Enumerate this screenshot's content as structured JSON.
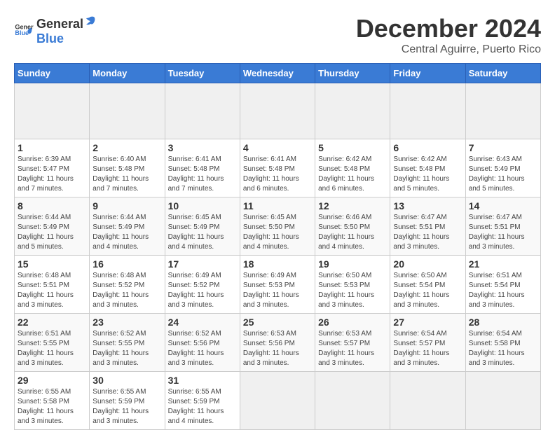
{
  "header": {
    "logo_general": "General",
    "logo_blue": "Blue",
    "month_title": "December 2024",
    "location": "Central Aguirre, Puerto Rico"
  },
  "calendar": {
    "days_of_week": [
      "Sunday",
      "Monday",
      "Tuesday",
      "Wednesday",
      "Thursday",
      "Friday",
      "Saturday"
    ],
    "weeks": [
      [
        {
          "day": "",
          "empty": true
        },
        {
          "day": "",
          "empty": true
        },
        {
          "day": "",
          "empty": true
        },
        {
          "day": "",
          "empty": true
        },
        {
          "day": "",
          "empty": true
        },
        {
          "day": "",
          "empty": true
        },
        {
          "day": "",
          "empty": true
        }
      ],
      [
        {
          "day": "1",
          "sunrise": "6:39 AM",
          "sunset": "5:47 PM",
          "daylight": "11 hours and 7 minutes."
        },
        {
          "day": "2",
          "sunrise": "6:40 AM",
          "sunset": "5:48 PM",
          "daylight": "11 hours and 7 minutes."
        },
        {
          "day": "3",
          "sunrise": "6:41 AM",
          "sunset": "5:48 PM",
          "daylight": "11 hours and 7 minutes."
        },
        {
          "day": "4",
          "sunrise": "6:41 AM",
          "sunset": "5:48 PM",
          "daylight": "11 hours and 6 minutes."
        },
        {
          "day": "5",
          "sunrise": "6:42 AM",
          "sunset": "5:48 PM",
          "daylight": "11 hours and 6 minutes."
        },
        {
          "day": "6",
          "sunrise": "6:42 AM",
          "sunset": "5:48 PM",
          "daylight": "11 hours and 5 minutes."
        },
        {
          "day": "7",
          "sunrise": "6:43 AM",
          "sunset": "5:49 PM",
          "daylight": "11 hours and 5 minutes."
        }
      ],
      [
        {
          "day": "8",
          "sunrise": "6:44 AM",
          "sunset": "5:49 PM",
          "daylight": "11 hours and 5 minutes."
        },
        {
          "day": "9",
          "sunrise": "6:44 AM",
          "sunset": "5:49 PM",
          "daylight": "11 hours and 4 minutes."
        },
        {
          "day": "10",
          "sunrise": "6:45 AM",
          "sunset": "5:49 PM",
          "daylight": "11 hours and 4 minutes."
        },
        {
          "day": "11",
          "sunrise": "6:45 AM",
          "sunset": "5:50 PM",
          "daylight": "11 hours and 4 minutes."
        },
        {
          "day": "12",
          "sunrise": "6:46 AM",
          "sunset": "5:50 PM",
          "daylight": "11 hours and 4 minutes."
        },
        {
          "day": "13",
          "sunrise": "6:47 AM",
          "sunset": "5:51 PM",
          "daylight": "11 hours and 3 minutes."
        },
        {
          "day": "14",
          "sunrise": "6:47 AM",
          "sunset": "5:51 PM",
          "daylight": "11 hours and 3 minutes."
        }
      ],
      [
        {
          "day": "15",
          "sunrise": "6:48 AM",
          "sunset": "5:51 PM",
          "daylight": "11 hours and 3 minutes."
        },
        {
          "day": "16",
          "sunrise": "6:48 AM",
          "sunset": "5:52 PM",
          "daylight": "11 hours and 3 minutes."
        },
        {
          "day": "17",
          "sunrise": "6:49 AM",
          "sunset": "5:52 PM",
          "daylight": "11 hours and 3 minutes."
        },
        {
          "day": "18",
          "sunrise": "6:49 AM",
          "sunset": "5:53 PM",
          "daylight": "11 hours and 3 minutes."
        },
        {
          "day": "19",
          "sunrise": "6:50 AM",
          "sunset": "5:53 PM",
          "daylight": "11 hours and 3 minutes."
        },
        {
          "day": "20",
          "sunrise": "6:50 AM",
          "sunset": "5:54 PM",
          "daylight": "11 hours and 3 minutes."
        },
        {
          "day": "21",
          "sunrise": "6:51 AM",
          "sunset": "5:54 PM",
          "daylight": "11 hours and 3 minutes."
        }
      ],
      [
        {
          "day": "22",
          "sunrise": "6:51 AM",
          "sunset": "5:55 PM",
          "daylight": "11 hours and 3 minutes."
        },
        {
          "day": "23",
          "sunrise": "6:52 AM",
          "sunset": "5:55 PM",
          "daylight": "11 hours and 3 minutes."
        },
        {
          "day": "24",
          "sunrise": "6:52 AM",
          "sunset": "5:56 PM",
          "daylight": "11 hours and 3 minutes."
        },
        {
          "day": "25",
          "sunrise": "6:53 AM",
          "sunset": "5:56 PM",
          "daylight": "11 hours and 3 minutes."
        },
        {
          "day": "26",
          "sunrise": "6:53 AM",
          "sunset": "5:57 PM",
          "daylight": "11 hours and 3 minutes."
        },
        {
          "day": "27",
          "sunrise": "6:54 AM",
          "sunset": "5:57 PM",
          "daylight": "11 hours and 3 minutes."
        },
        {
          "day": "28",
          "sunrise": "6:54 AM",
          "sunset": "5:58 PM",
          "daylight": "11 hours and 3 minutes."
        }
      ],
      [
        {
          "day": "29",
          "sunrise": "6:55 AM",
          "sunset": "5:58 PM",
          "daylight": "11 hours and 3 minutes."
        },
        {
          "day": "30",
          "sunrise": "6:55 AM",
          "sunset": "5:59 PM",
          "daylight": "11 hours and 3 minutes."
        },
        {
          "day": "31",
          "sunrise": "6:55 AM",
          "sunset": "5:59 PM",
          "daylight": "11 hours and 4 minutes."
        },
        {
          "day": "",
          "empty": true
        },
        {
          "day": "",
          "empty": true
        },
        {
          "day": "",
          "empty": true
        },
        {
          "day": "",
          "empty": true
        }
      ]
    ],
    "labels": {
      "sunrise": "Sunrise:",
      "sunset": "Sunset:",
      "daylight": "Daylight:"
    }
  }
}
